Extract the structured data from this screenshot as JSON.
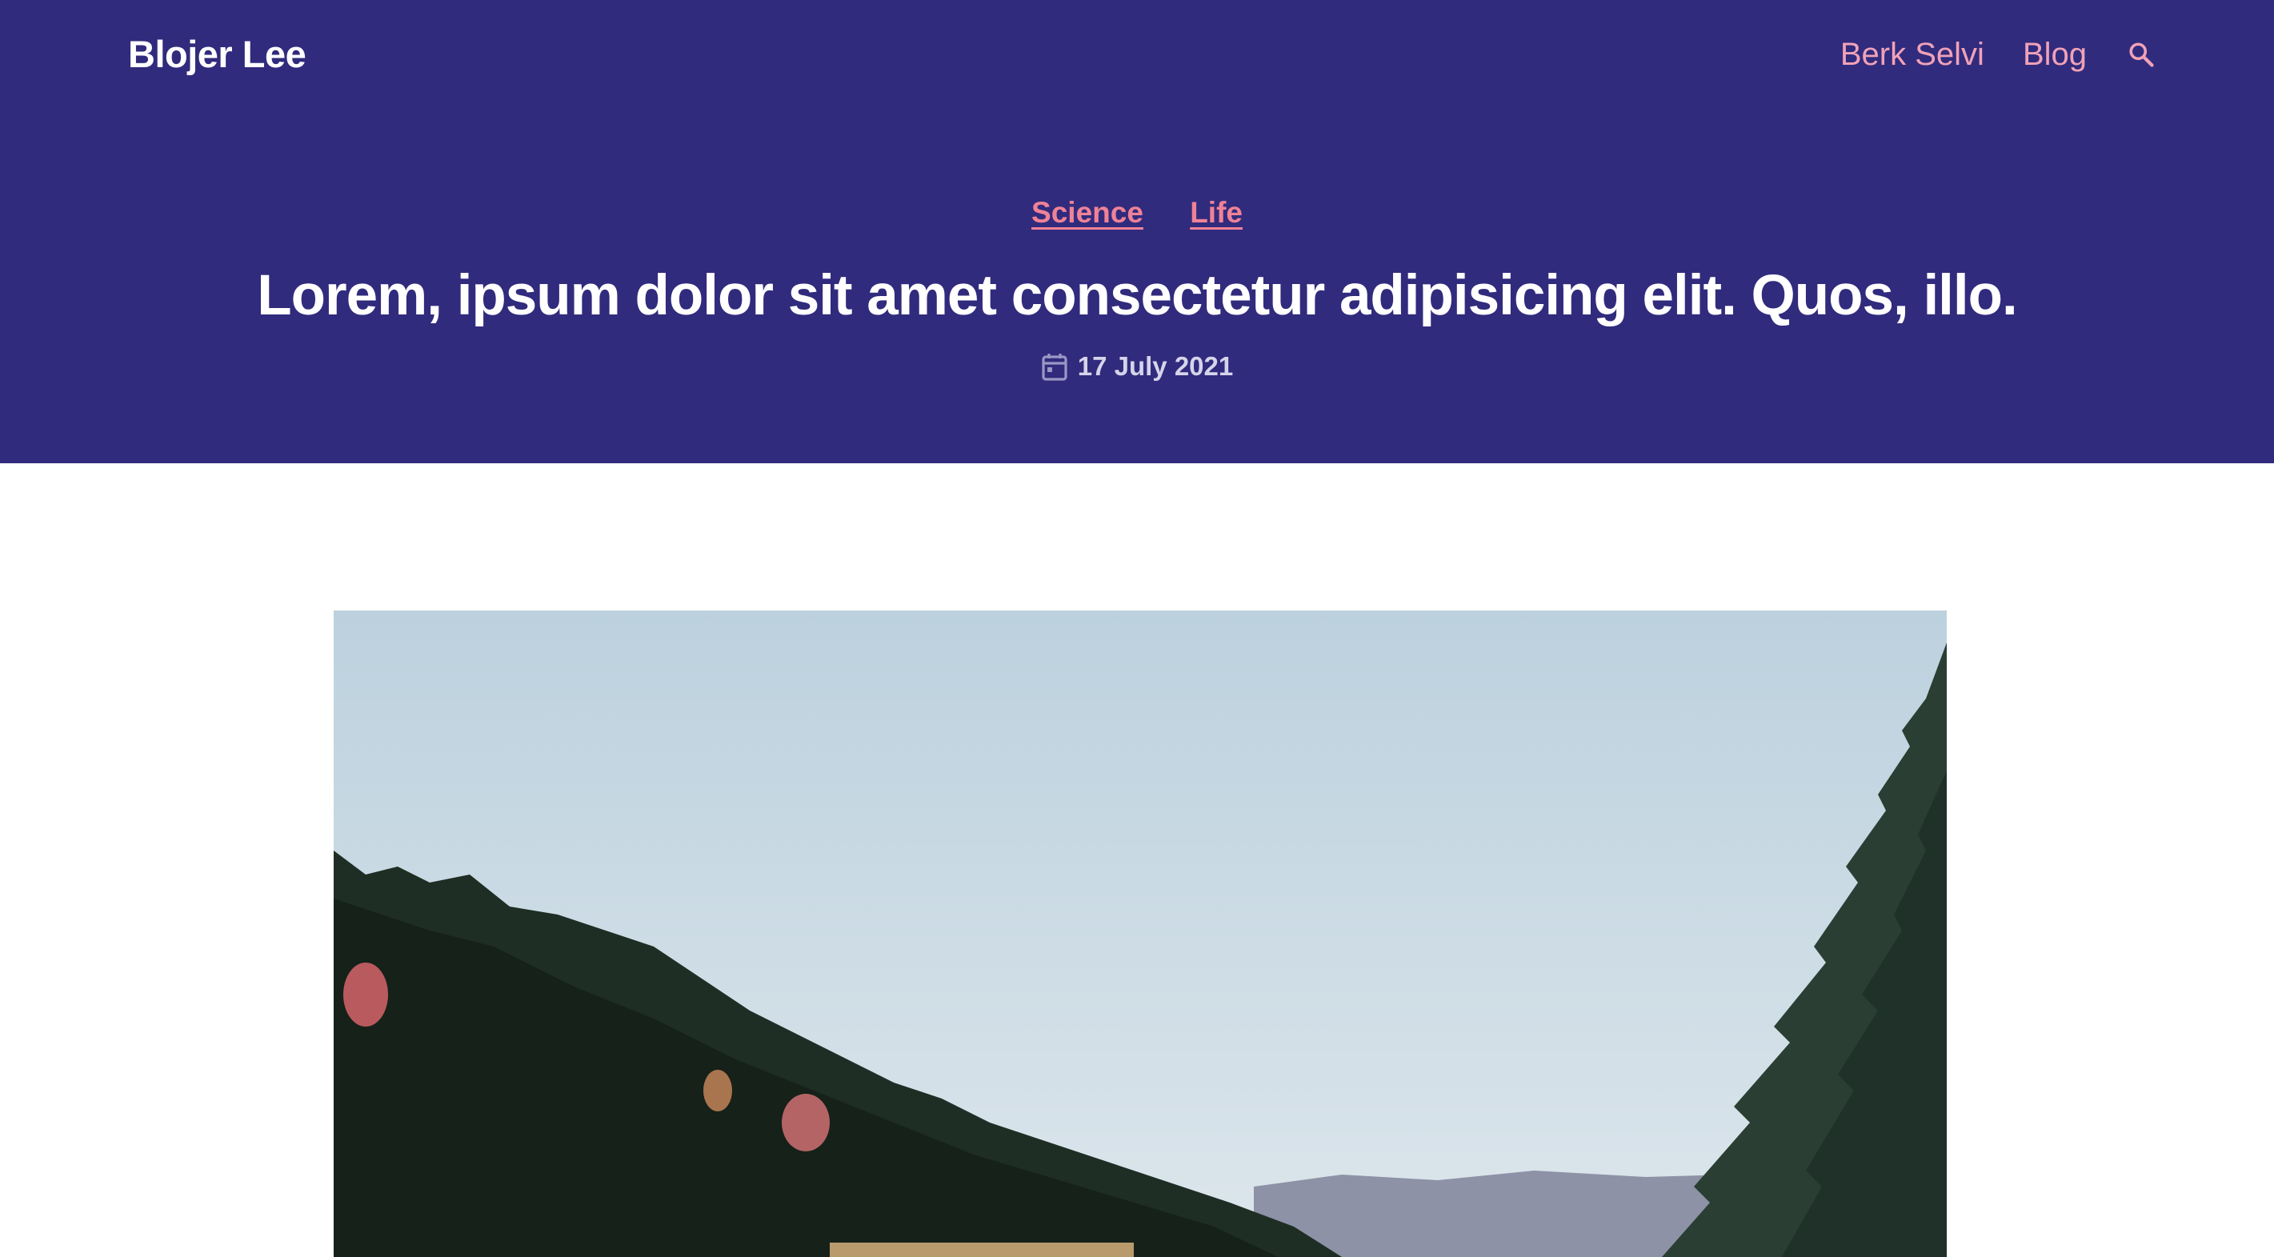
{
  "site": {
    "title": "Blojer Lee"
  },
  "nav": {
    "items": [
      {
        "label": "Berk Selvi"
      },
      {
        "label": "Blog"
      }
    ],
    "search_icon": "search-icon"
  },
  "post": {
    "categories": [
      {
        "label": "Science"
      },
      {
        "label": "Life"
      }
    ],
    "title": "Lorem, ipsum dolor sit amet consectetur adipisicing elit. Quos, illo.",
    "date": "17 July 2021",
    "date_icon": "calendar-icon"
  },
  "colors": {
    "hero_background": "#312b7d",
    "nav_link": "#f0a2b8",
    "category_link": "#ef8297",
    "title": "#ffffff",
    "meta": "#d6d4ea"
  }
}
